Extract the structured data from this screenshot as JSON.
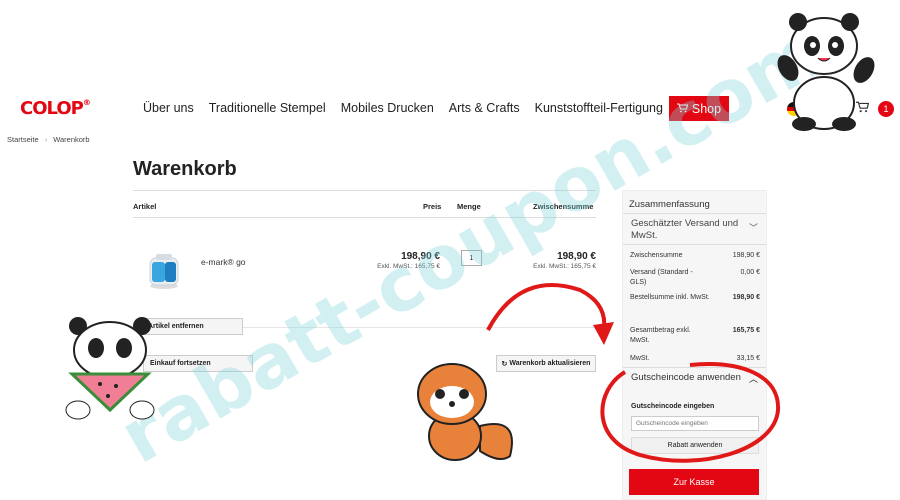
{
  "header": {
    "logo": "COLOP",
    "logo_mark": "®",
    "nav": [
      "Über uns",
      "Traditionelle Stempel",
      "Mobiles Drucken",
      "Arts & Crafts",
      "Kunststoffteil-Fertigung"
    ],
    "shop_label": "Shop",
    "cart_count": "1",
    "accent": "#e30613"
  },
  "breadcrumb": {
    "home": "Startseite",
    "current": "Warenkorb"
  },
  "page_title": "Warenkorb",
  "cart": {
    "columns": {
      "article": "Artikel",
      "price": "Preis",
      "qty": "Menge",
      "subtotal": "Zwischensumme"
    },
    "item": {
      "name": "e-mark® go",
      "price": "198,90 €",
      "price_excl": "Exkl. MwSt.: 165,75 €",
      "qty": "1",
      "subtotal": "198,90 €",
      "subtotal_excl": "Exkl. MwSt.: 165,75 €"
    },
    "remove_label": "Artikel entfernen",
    "continue_label": "Einkauf fortsetzen",
    "update_label": "Warenkorb aktualisieren"
  },
  "summary": {
    "title": "Zusammenfassung",
    "shipping_estimate": "Geschätzter Versand und MwSt.",
    "lines": [
      {
        "label": "Zwischensumme",
        "value": "198,90 €",
        "bold": false
      },
      {
        "label": "Versand (Standard - GLS)",
        "value": "0,00 €",
        "bold": false
      },
      {
        "label": "Bestellsumme inkl. MwSt.",
        "value": "198,90 €",
        "bold": true
      },
      {
        "label": "Gesamtbetrag exkl. MwSt.",
        "value": "165,75 €",
        "bold": true
      },
      {
        "label": "MwSt.",
        "value": "33,15 €",
        "bold": false
      }
    ],
    "coupon_title": "Gutscheincode anwenden",
    "coupon_label": "Gutscheincode eingeben",
    "coupon_placeholder": "Gutscheincode eingeben",
    "apply_label": "Rabatt anwenden",
    "checkout_label": "Zur Kasse"
  },
  "watermark": "rabatt-coupon.com"
}
